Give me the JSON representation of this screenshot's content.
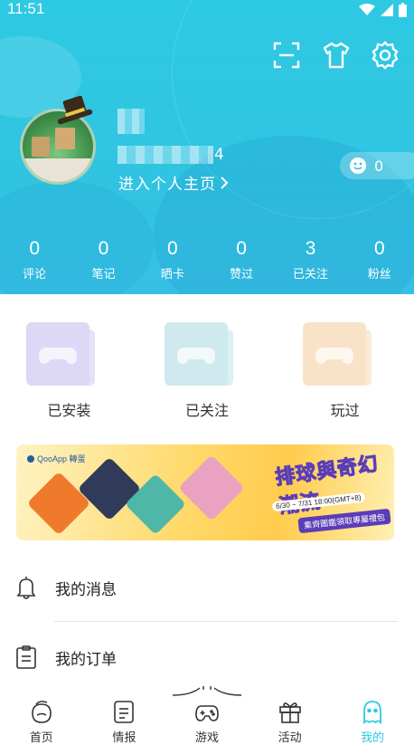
{
  "status_bar": {
    "time": "11:51"
  },
  "header": {
    "icons": [
      "scan-icon",
      "tshirt-icon",
      "gear-icon"
    ],
    "profile": {
      "id_suffix": "4",
      "homepage_link": "进入个人主页"
    },
    "coins": {
      "value": "0"
    },
    "stats": [
      {
        "value": "0",
        "label": "评论"
      },
      {
        "value": "0",
        "label": "笔记"
      },
      {
        "value": "0",
        "label": "晒卡"
      },
      {
        "value": "0",
        "label": "赞过"
      },
      {
        "value": "3",
        "label": "已关注"
      },
      {
        "value": "0",
        "label": "粉丝"
      }
    ]
  },
  "shortcuts": [
    {
      "label": "已安装",
      "color": "#dcd8f6"
    },
    {
      "label": "已关注",
      "color": "#cfeaee"
    },
    {
      "label": "玩过",
      "color": "#f8e3c8"
    }
  ],
  "banner": {
    "logo_text": "QooApp 轉蛋",
    "headline": "排球與奇幻潮流",
    "date": "6/30 ~ 7/31 18:00(GMT+8)",
    "sub": "集齊圖鑑領取專屬禮包"
  },
  "list": [
    {
      "label": "我的消息",
      "icon": "bell-icon"
    },
    {
      "label": "我的订单",
      "icon": "clipboard-icon"
    }
  ],
  "bottom_nav": [
    {
      "label": "首页",
      "icon": "home-mascot-icon",
      "active": false
    },
    {
      "label": "情报",
      "icon": "news-icon",
      "active": false
    },
    {
      "label": "游戏",
      "icon": "gamepad-icon",
      "active": false
    },
    {
      "label": "活动",
      "icon": "gift-icon",
      "active": false
    },
    {
      "label": "我的",
      "icon": "profile-ghost-icon",
      "active": true
    }
  ],
  "colors": {
    "accent": "#2ec9e3",
    "header_bg": "#30c4e2"
  }
}
